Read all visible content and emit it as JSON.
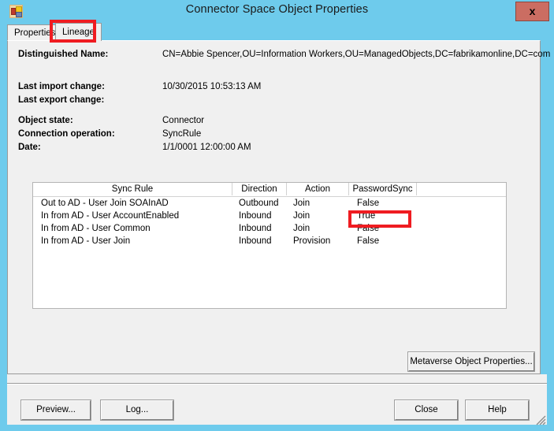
{
  "window": {
    "title": "Connector Space Object Properties",
    "app_icon": "application-icon",
    "close_label": "x",
    "titlebar_color": "#6ecbec",
    "annotation_color": "#ef1c21"
  },
  "tabs": [
    {
      "label": "Properties",
      "active": false
    },
    {
      "label": "Lineage",
      "active": true
    }
  ],
  "details": {
    "distinguished_name_label": "Distinguished Name:",
    "distinguished_name_value": "CN=Abbie Spencer,OU=Information Workers,OU=ManagedObjects,DC=fabrikamonline,DC=com",
    "last_import_change_label": "Last import change:",
    "last_import_change_value": "10/30/2015 10:53:13 AM",
    "last_export_change_label": "Last export change:",
    "last_export_change_value": "",
    "object_state_label": "Object state:",
    "object_state_value": "Connector",
    "connection_operation_label": "Connection operation:",
    "connection_operation_value": "SyncRule",
    "date_label": "Date:",
    "date_value": "1/1/0001 12:00:00 AM"
  },
  "grid": {
    "columns": [
      "Sync Rule",
      "Direction",
      "Action",
      "PasswordSync",
      ""
    ],
    "rows": [
      {
        "sync_rule": "Out to AD - User Join SOAInAD",
        "direction": "Outbound",
        "action": "Join",
        "password_sync": "False"
      },
      {
        "sync_rule": "In from AD - User AccountEnabled",
        "direction": "Inbound",
        "action": "Join",
        "password_sync": "True"
      },
      {
        "sync_rule": "In from AD - User Common",
        "direction": "Inbound",
        "action": "Join",
        "password_sync": "False"
      },
      {
        "sync_rule": "In from AD - User Join",
        "direction": "Inbound",
        "action": "Provision",
        "password_sync": "False"
      }
    ]
  },
  "buttons": {
    "metaverse_object_properties": "Metaverse Object Properties...",
    "preview": "Preview...",
    "log": "Log...",
    "close": "Close",
    "help": "Help"
  }
}
